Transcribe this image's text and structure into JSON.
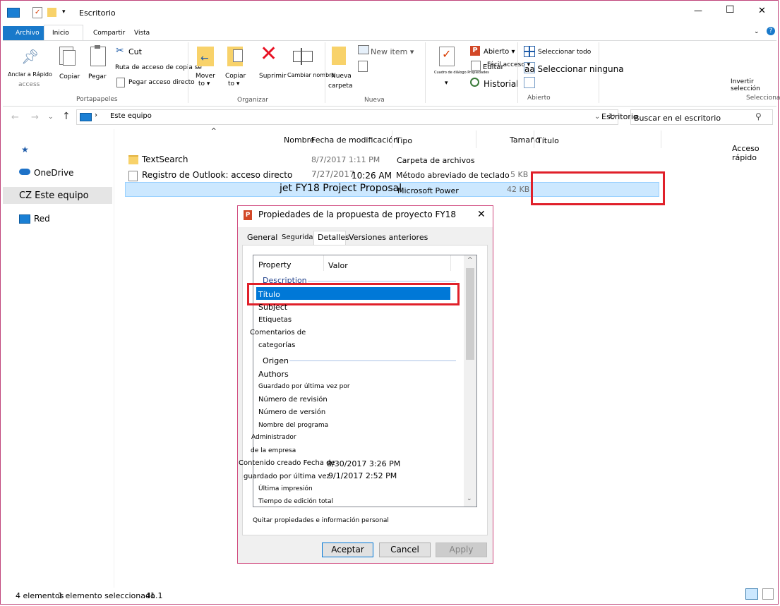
{
  "window": {
    "title": "Escritorio",
    "controls": {
      "minimize": "—",
      "maximize": "☐",
      "close": "✕"
    }
  },
  "ribbon": {
    "tabs": [
      "Archivo",
      "Inicio",
      "Compartir",
      "Vista"
    ],
    "clipboard": {
      "pin_label": "Anclar a Rápido",
      "pin_label2": "access",
      "copy": "Copiar",
      "paste": "Pegar",
      "cut": "Cut",
      "copy_path": "Ruta de acceso de copia se",
      "paste_shortcut": "Pegar acceso directo",
      "group": "Portapapeles"
    },
    "organize": {
      "move": "Mover",
      "move2": "to ▾",
      "copy": "Copiar",
      "copy2": "to ▾",
      "delete": "Suprimir",
      "rename": "Cambiar nombre",
      "group": "Organizar"
    },
    "new": {
      "new_item": "New item ▾",
      "new_folder": "Nueva",
      "new_folder2": "carpeta",
      "group": "Nueva"
    },
    "open": {
      "properties": "Cuadro de diálogo Propiedades",
      "open": "Abierto ▾",
      "edit": "Editar",
      "easy_access": "Fácil acceso ▾",
      "history": "Historial",
      "group": "Abierto"
    },
    "select": {
      "select_all": "Seleccionar todo",
      "select_none": "aa Seleccionar ninguna",
      "invert": "Invertir selección",
      "group": "Seleccionar"
    }
  },
  "address": {
    "path": "Este equipo",
    "location": "Escritorio",
    "search_placeholder": "Buscar en el escritorio"
  },
  "sidebar": {
    "items": [
      "",
      "OneDrive",
      "CZ Este equipo",
      "Red"
    ],
    "quick_access": "Acceso rápido"
  },
  "columns": [
    "Nombre",
    "Fecha de modificación",
    "Tipo",
    "Tamaño",
    "Título"
  ],
  "files": [
    {
      "name": "TextSearch",
      "date": "8/7/2017 1:11 PM",
      "type": "Carpeta de archivos",
      "size": ""
    },
    {
      "name": "Registro de Outlook: acceso directo",
      "date": "7/27/2017",
      "time": "10:26 AM",
      "type": "Método abreviado de teclado",
      "size": "5 KB"
    },
    {
      "name": "jet FY18 Project Proposal",
      "date": "",
      "type": "Microsoft Power",
      "size": "42 KB"
    }
  ],
  "status": {
    "count": "4 elementos",
    "selected": "1 elemento seleccionado",
    "size": "41.1"
  },
  "dialog": {
    "title": "Propiedades de la propuesta de proyecto FY18",
    "tabs": [
      "General",
      "Seguridad",
      "Detalles",
      "Versiones anteriores"
    ],
    "col_property": "Property",
    "col_value": "Valor",
    "section_description": "Description",
    "section_origin": "Origen",
    "props": [
      "Título",
      "Subject",
      "Etiquetas",
      "Comentarios de",
      "categorías",
      "Authors",
      "Guardado por última vez por",
      "Número de revisión",
      "Número de versión",
      "Nombre del programa",
      "Administrador",
      "de la empresa",
      "Contenido creado Fecha de",
      "guardado por última vez",
      "Última impresión",
      "Tiempo de edición total"
    ],
    "values": {
      "created": "8/30/2017 3:26 PM",
      "saved": "9/1/2017 2:52 PM"
    },
    "remove_link": "Quitar propiedades e información personal",
    "buttons": {
      "ok": "Aceptar",
      "cancel": "Cancel",
      "apply": "Apply"
    }
  }
}
